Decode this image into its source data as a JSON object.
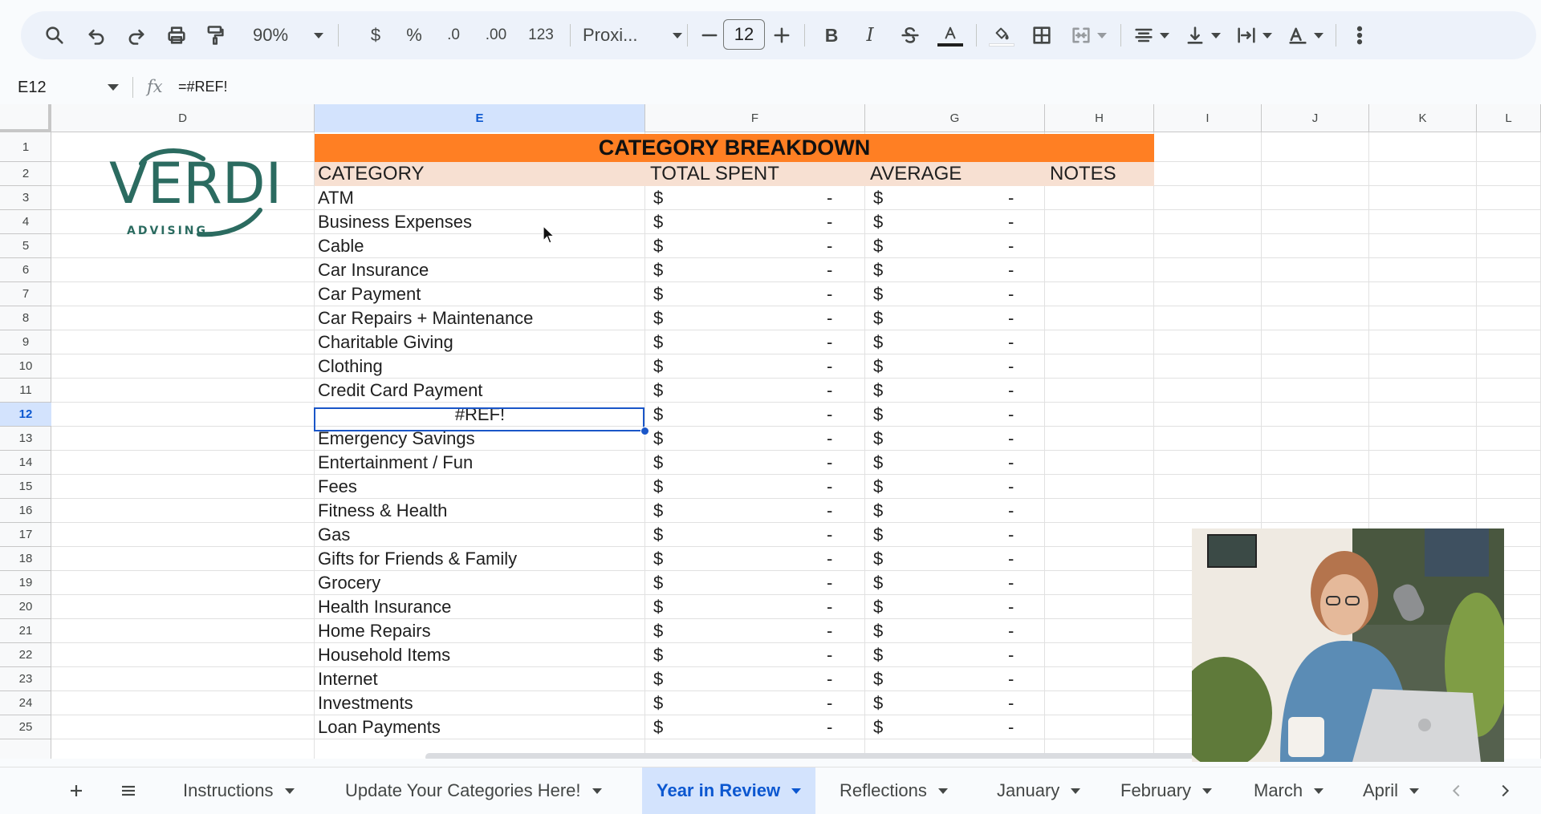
{
  "toolbar": {
    "zoom": "90%",
    "currency": "$",
    "percent": "%",
    "decrease_decimal": ".0",
    "increase_decimal": ".00",
    "number_format": "123",
    "font": "Proxi...",
    "font_size": "12",
    "bold": "B",
    "italic": "I"
  },
  "formula_bar": {
    "cell_ref": "E12",
    "fx": "fx",
    "formula": "=#REF!"
  },
  "columns": [
    "D",
    "E",
    "F",
    "G",
    "H",
    "I",
    "J",
    "K",
    "L"
  ],
  "rows": [
    "1",
    "2",
    "3",
    "4",
    "5",
    "6",
    "7",
    "8",
    "9",
    "10",
    "11",
    "12",
    "13",
    "14",
    "15",
    "16",
    "17",
    "18",
    "19",
    "20",
    "21",
    "22",
    "23",
    "24",
    "25"
  ],
  "selected_cell": {
    "column": "E",
    "row": "12"
  },
  "logo": {
    "word": "VERDI",
    "sub": "ADVISING"
  },
  "table": {
    "title": "CATEGORY BREAKDOWN",
    "headers": [
      "CATEGORY",
      "TOTAL SPENT",
      "AVERAGE",
      "NOTES"
    ],
    "currency_symbol": "$",
    "empty_value": "-",
    "categories": [
      "ATM",
      "Business Expenses",
      "Cable",
      "Car Insurance",
      "Car Payment",
      "Car Repairs + Maintenance",
      "Charitable Giving",
      "Clothing",
      "Credit Card Payment",
      "#REF!",
      "Emergency Savings",
      "Entertainment / Fun",
      "Fees",
      "Fitness & Health",
      "Gas",
      "Gifts for Friends & Family",
      "Grocery",
      "Health Insurance",
      "Home Repairs",
      "Household Items",
      "Internet",
      "Investments",
      "Loan Payments"
    ]
  },
  "sheet_tabs": [
    {
      "label": "Instructions",
      "active": false
    },
    {
      "label": "Update Your Categories Here!",
      "active": false
    },
    {
      "label": "Year in Review",
      "active": true
    },
    {
      "label": "Reflections",
      "active": false
    },
    {
      "label": "January",
      "active": false
    },
    {
      "label": "February",
      "active": false
    },
    {
      "label": "March",
      "active": false
    },
    {
      "label": "April",
      "active": false
    }
  ],
  "colors": {
    "title_band": "#ff7f23",
    "header_band": "#f7e0d2",
    "selection": "#1a56c8",
    "logo": "#2b6b60",
    "active_tab": "#d3e3fd"
  }
}
